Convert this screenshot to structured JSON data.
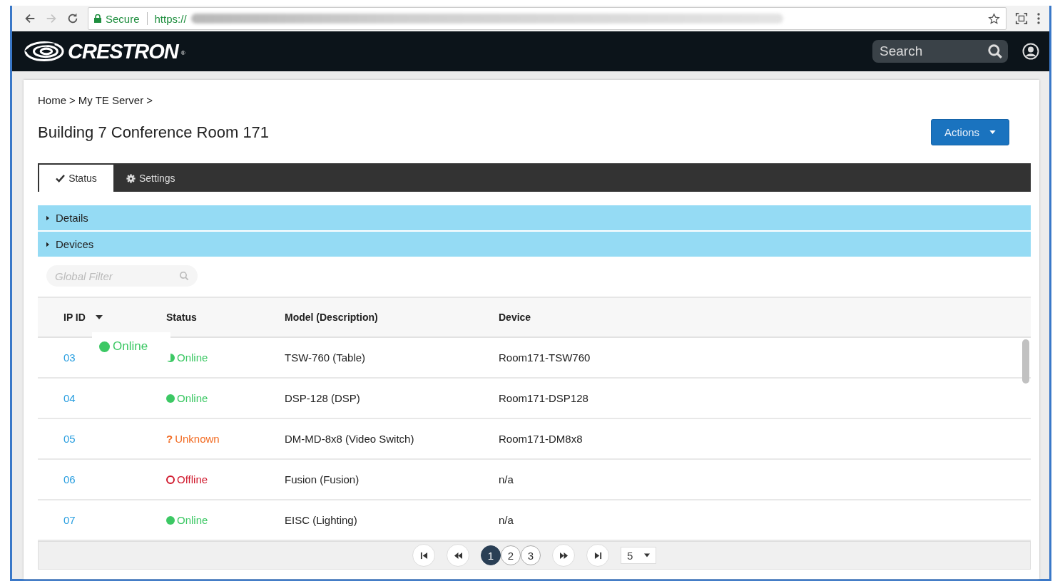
{
  "browser": {
    "back_disabled": false,
    "forward_disabled": true,
    "security_label": "Secure",
    "url_visible": "https://"
  },
  "header": {
    "logo_text": "CRESTRON",
    "logo_mark": "®",
    "search": {
      "placeholder": "Search"
    }
  },
  "breadcrumb": [
    {
      "label": "Home",
      "separator": ">"
    },
    {
      "label": "My TE Server",
      "separator": ">"
    }
  ],
  "page_title": "Building 7 Conference Room 171",
  "actions_button": {
    "label": "Actions"
  },
  "tabs": [
    {
      "label": "Status",
      "selected": true
    },
    {
      "label": "Settings",
      "selected": false
    }
  ],
  "sections": [
    {
      "label": "Details",
      "expanded": false
    },
    {
      "label": "Devices",
      "expanded": false
    }
  ],
  "filter": {
    "placeholder": "Global Filter"
  },
  "table": {
    "columns": [
      {
        "label": "IP ID",
        "sorted": true
      },
      {
        "label": "Status",
        "sorted": false
      },
      {
        "label": "Model (Description)",
        "sorted": false
      },
      {
        "label": "Device",
        "sorted": false
      }
    ],
    "rows": [
      {
        "ip_id": "03",
        "status": {
          "kind": "online",
          "label": "Online"
        },
        "model": "TSW-760 (Table)",
        "device": "Room171-TSW760"
      },
      {
        "ip_id": "04",
        "status": {
          "kind": "online",
          "label": "Online"
        },
        "model": "DSP-128 (DSP)",
        "device": "Room171-DSP128"
      },
      {
        "ip_id": "05",
        "status": {
          "kind": "unknown",
          "symbol": "?",
          "label": "Unknown"
        },
        "model": "DM-MD-8x8 (Video Switch)",
        "device": "Room171-DM8x8"
      },
      {
        "ip_id": "06",
        "status": {
          "kind": "offline",
          "label": "Offline"
        },
        "model": "Fusion (Fusion)",
        "device": "n/a"
      },
      {
        "ip_id": "07",
        "status": {
          "kind": "online",
          "label": "Online"
        },
        "model": "EISC (Lighting)",
        "device": "n/a"
      }
    ]
  },
  "drag_ghost": {
    "kind": "online",
    "label": "Online"
  },
  "pagination": {
    "pages": [
      {
        "label": "1",
        "selected": true
      },
      {
        "label": "2",
        "selected": false
      },
      {
        "label": "3",
        "selected": false
      }
    ],
    "page_size": "5"
  }
}
